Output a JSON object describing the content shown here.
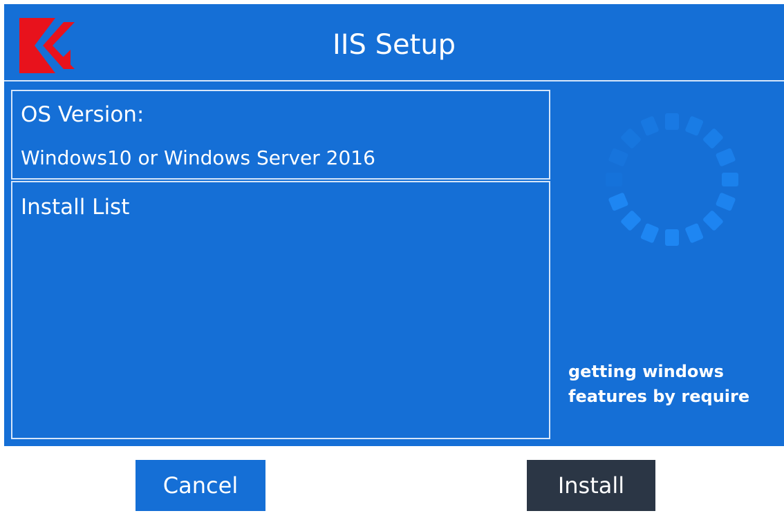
{
  "window": {
    "title": "IIS Setup",
    "logo_icon": "red-k-logo-icon"
  },
  "os_panel": {
    "label": "OS Version:",
    "value": "Windows10 or Windows Server 2016"
  },
  "install_panel": {
    "label": "Install List",
    "items": []
  },
  "status": {
    "spinner_icon": "loading-spinner-icon",
    "line1": "getting windows",
    "line2": "features by require"
  },
  "buttons": {
    "cancel_label": "Cancel",
    "install_label": "Install"
  },
  "colors": {
    "primary_blue": "#156fd6",
    "install_button": "#2b3645",
    "logo_red": "#e8121c",
    "panel_border": "#d6e6fa",
    "spinner_blue": "#1e86f2"
  }
}
